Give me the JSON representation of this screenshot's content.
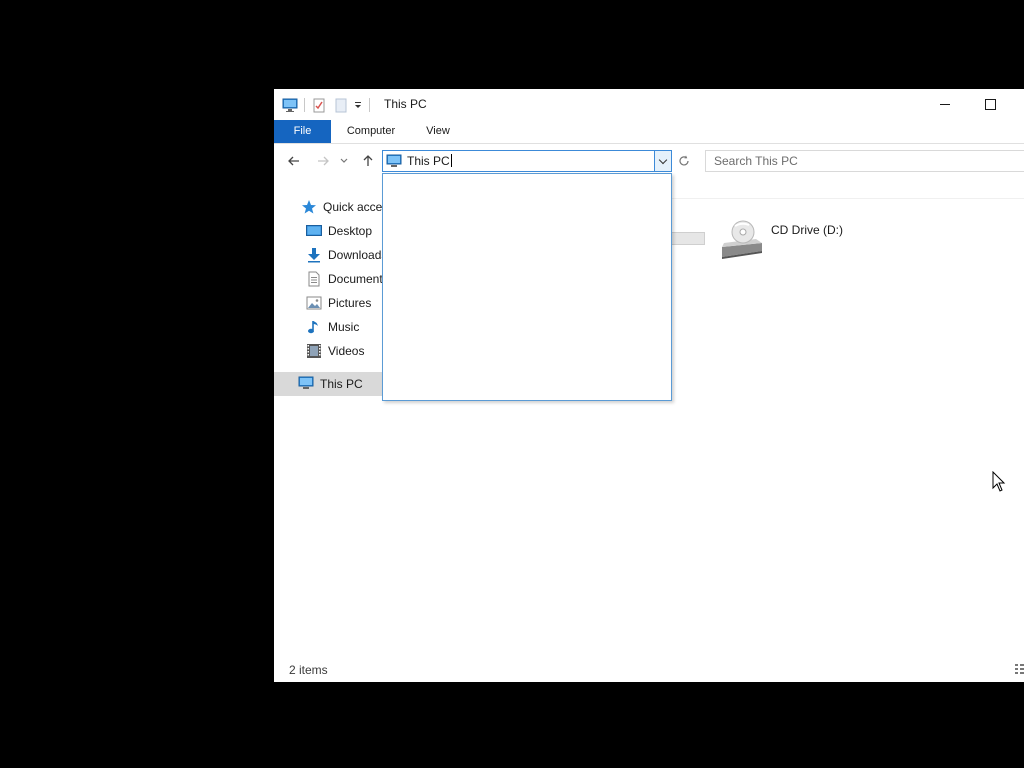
{
  "window": {
    "title": "This PC"
  },
  "ribbon": {
    "tabs": [
      {
        "label": "File",
        "active": true
      },
      {
        "label": "Computer",
        "active": false
      },
      {
        "label": "View",
        "active": false
      }
    ]
  },
  "navbar": {
    "back_icon": "arrow-left-icon",
    "forward_icon": "arrow-right-icon",
    "up_icon": "arrow-up-icon",
    "address_value": "This PC",
    "search_placeholder": "Search This PC"
  },
  "navpane": {
    "quick_access": "Quick access",
    "items": [
      {
        "label": "Desktop",
        "icon": "desktop-folder-icon"
      },
      {
        "label": "Downloads",
        "icon": "downloads-folder-icon"
      },
      {
        "label": "Documents",
        "icon": "documents-folder-icon"
      },
      {
        "label": "Pictures",
        "icon": "pictures-folder-icon"
      },
      {
        "label": "Music",
        "icon": "music-folder-icon"
      },
      {
        "label": "Videos",
        "icon": "videos-folder-icon"
      }
    ],
    "this_pc": "This PC"
  },
  "content": {
    "drives": [
      {
        "label": "CD Drive (D:)",
        "icon": "cd-drive-icon"
      }
    ]
  },
  "statusbar": {
    "item_count": "2 items"
  },
  "colors": {
    "file_tab": "#1565c0",
    "address_border": "#3c8ad8",
    "selected_bg": "#d9d9d9"
  }
}
